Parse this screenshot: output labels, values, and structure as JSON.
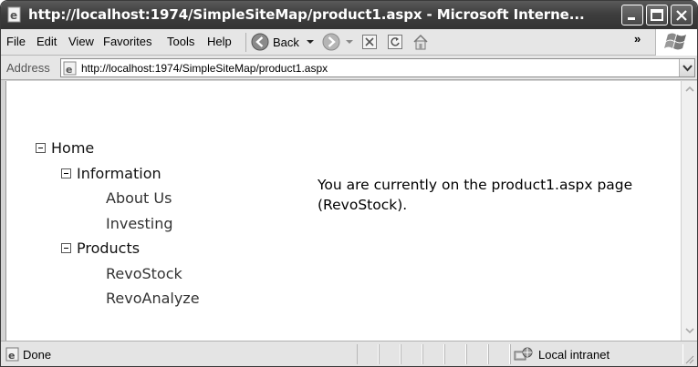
{
  "window": {
    "title": "http://localhost:1974/SimpleSiteMap/product1.aspx - Microsoft Interne..."
  },
  "menu": {
    "items": [
      "File",
      "Edit",
      "View",
      "Favorites",
      "Tools",
      "Help"
    ],
    "back_label": "Back",
    "overflow": "»"
  },
  "address": {
    "label": "Address",
    "url": "http://localhost:1974/SimpleSiteMap/product1.aspx"
  },
  "tree": {
    "root": "Home",
    "groups": [
      {
        "label": "Information",
        "children": [
          "About Us",
          "Investing"
        ]
      },
      {
        "label": "Products",
        "children": [
          "RevoStock",
          "RevoAnalyze"
        ]
      }
    ]
  },
  "content": {
    "message": "You are currently on the product1.aspx page (RevoStock)."
  },
  "status": {
    "text": "Done",
    "zone": "Local intranet"
  },
  "icons": {
    "app": "ie-page-icon",
    "back": "back-arrow-icon",
    "forward": "forward-arrow-icon",
    "stop": "stop-icon",
    "refresh": "refresh-icon",
    "home": "home-icon",
    "windows_logo": "windows-logo-icon"
  }
}
